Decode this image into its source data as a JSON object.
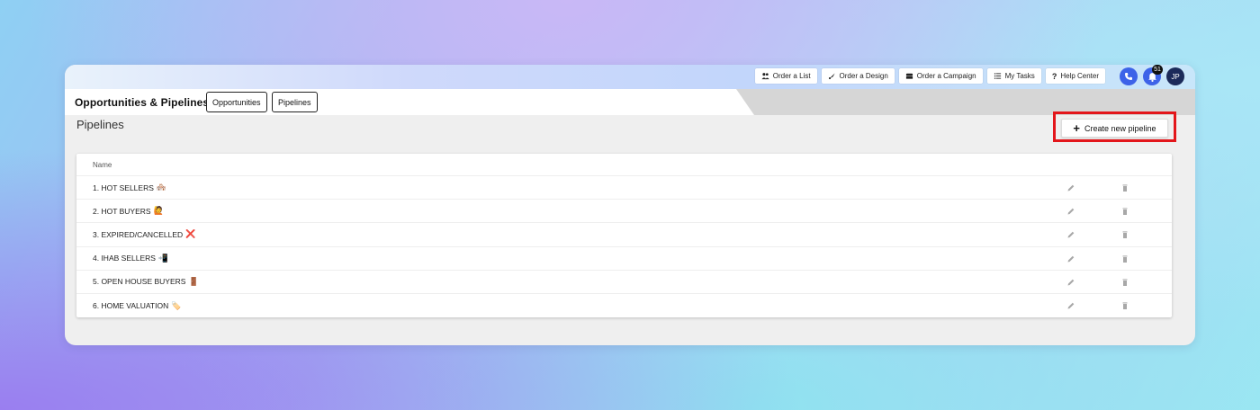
{
  "topbar": {
    "buttons": [
      {
        "label": "Order a List",
        "icon": "users-icon"
      },
      {
        "label": "Order a Design",
        "icon": "rocket-icon"
      },
      {
        "label": "Order a Campaign",
        "icon": "mailbox-icon"
      },
      {
        "label": "My Tasks",
        "icon": "list-icon"
      },
      {
        "label": "Help Center",
        "icon": "question-icon"
      }
    ],
    "notifications_count": "51",
    "avatar_initials": "JP"
  },
  "header": {
    "title": "Opportunities & Pipelines",
    "tabs": [
      {
        "label": "Opportunities"
      },
      {
        "label": "Pipelines"
      }
    ]
  },
  "main": {
    "section_title": "Pipelines",
    "create_button_label": "Create new pipeline",
    "table": {
      "column_name": "Name",
      "rows": [
        {
          "name": "1. HOT SELLERS",
          "emoji": "🏘️"
        },
        {
          "name": "2. HOT BUYERS",
          "emoji": "🙋"
        },
        {
          "name": "3. EXPIRED/CANCELLED",
          "emoji": "❌"
        },
        {
          "name": "4. IHAB SELLERS",
          "emoji": "📲"
        },
        {
          "name": "5. OPEN HOUSE BUYERS",
          "emoji": "🚪"
        },
        {
          "name": "6. HOME VALUATION",
          "emoji": "🏷️"
        }
      ]
    }
  },
  "colors": {
    "accent_blue": "#3d63e8",
    "highlight_red": "#e3161b"
  }
}
